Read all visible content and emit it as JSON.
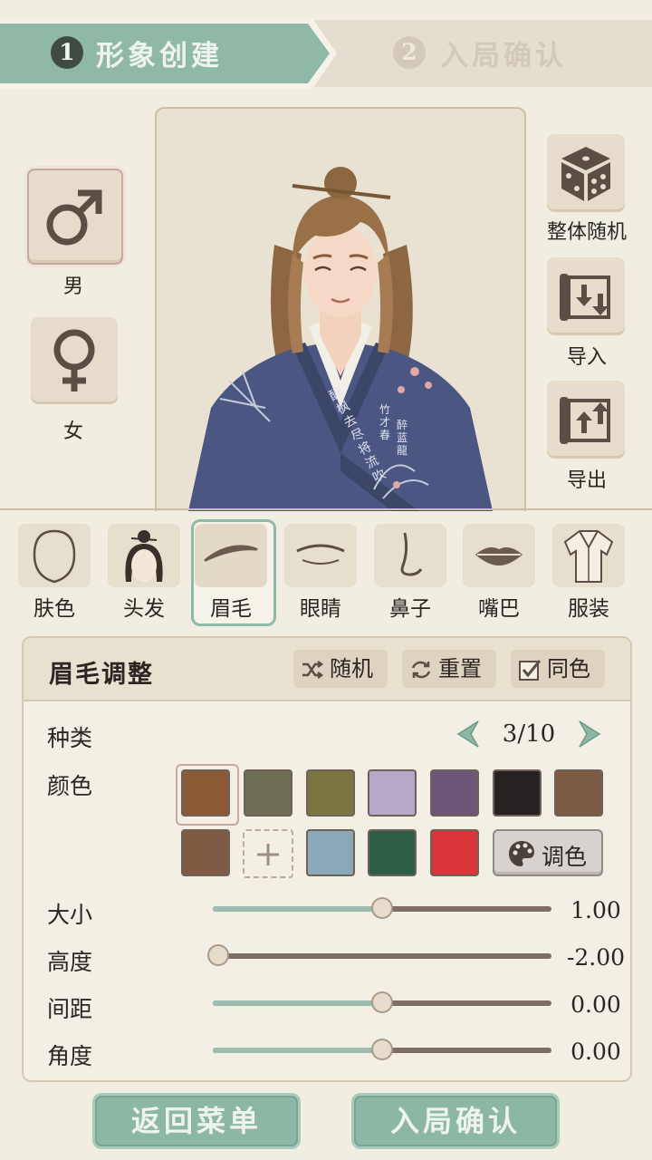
{
  "steps": [
    {
      "num": "1",
      "label": "形象创建",
      "active": true
    },
    {
      "num": "2",
      "label": "入局确认",
      "active": false
    }
  ],
  "gender": {
    "male": {
      "label": "男",
      "icon": "male-symbol-icon",
      "selected": true
    },
    "female": {
      "label": "女",
      "icon": "female-symbol-icon",
      "selected": false
    }
  },
  "actions": {
    "random_all": {
      "label": "整体随机",
      "icon": "dice-icon"
    },
    "import": {
      "label": "导入",
      "icon": "scroll-import-icon"
    },
    "export": {
      "label": "导出",
      "icon": "scroll-export-icon"
    }
  },
  "portrait": {
    "robe_text": [
      "醉枫去尽将流吹",
      "竹才春",
      "醉蓝龍"
    ]
  },
  "feature_tabs": [
    {
      "label": "肤色",
      "icon": "face-outline-icon"
    },
    {
      "label": "头发",
      "icon": "hair-bun-icon"
    },
    {
      "label": "眉毛",
      "icon": "eyebrow-icon",
      "selected": true
    },
    {
      "label": "眼睛",
      "icon": "eye-icon"
    },
    {
      "label": "鼻子",
      "icon": "nose-icon"
    },
    {
      "label": "嘴巴",
      "icon": "lips-icon"
    },
    {
      "label": "服装",
      "icon": "robe-icon"
    }
  ],
  "adjust": {
    "title": "眉毛调整",
    "random_label": "随机",
    "reset_label": "重置",
    "same_color_label": "同色",
    "same_color_checked": true,
    "type_label": "种类",
    "type_value": "3/10",
    "color_label": "颜色",
    "swatches_row1": [
      "#8a5b36",
      "#6e6e55",
      "#7a7642",
      "#b6a8c6",
      "#6d5677",
      "#262221",
      "#7c5a44"
    ],
    "swatches_row2": [
      "#7f5b45",
      "#8ba8b8",
      "#2d5e45",
      "#d9353a"
    ],
    "selected_swatch": 0,
    "palette_label": "调色",
    "sliders": [
      {
        "label": "大小",
        "value": "1.00",
        "fraction": 0.5
      },
      {
        "label": "高度",
        "value": "-2.00",
        "fraction": 0.0
      },
      {
        "label": "间距",
        "value": "0.00",
        "fraction": 0.5
      },
      {
        "label": "角度",
        "value": "0.00",
        "fraction": 0.5
      }
    ]
  },
  "bottom": {
    "back_label": "返回菜单",
    "confirm_label": "入局确认"
  },
  "colors": {
    "accent_green": "#8cb7a5",
    "background": "#f1ede1",
    "robe_navy": "#4b5782"
  }
}
